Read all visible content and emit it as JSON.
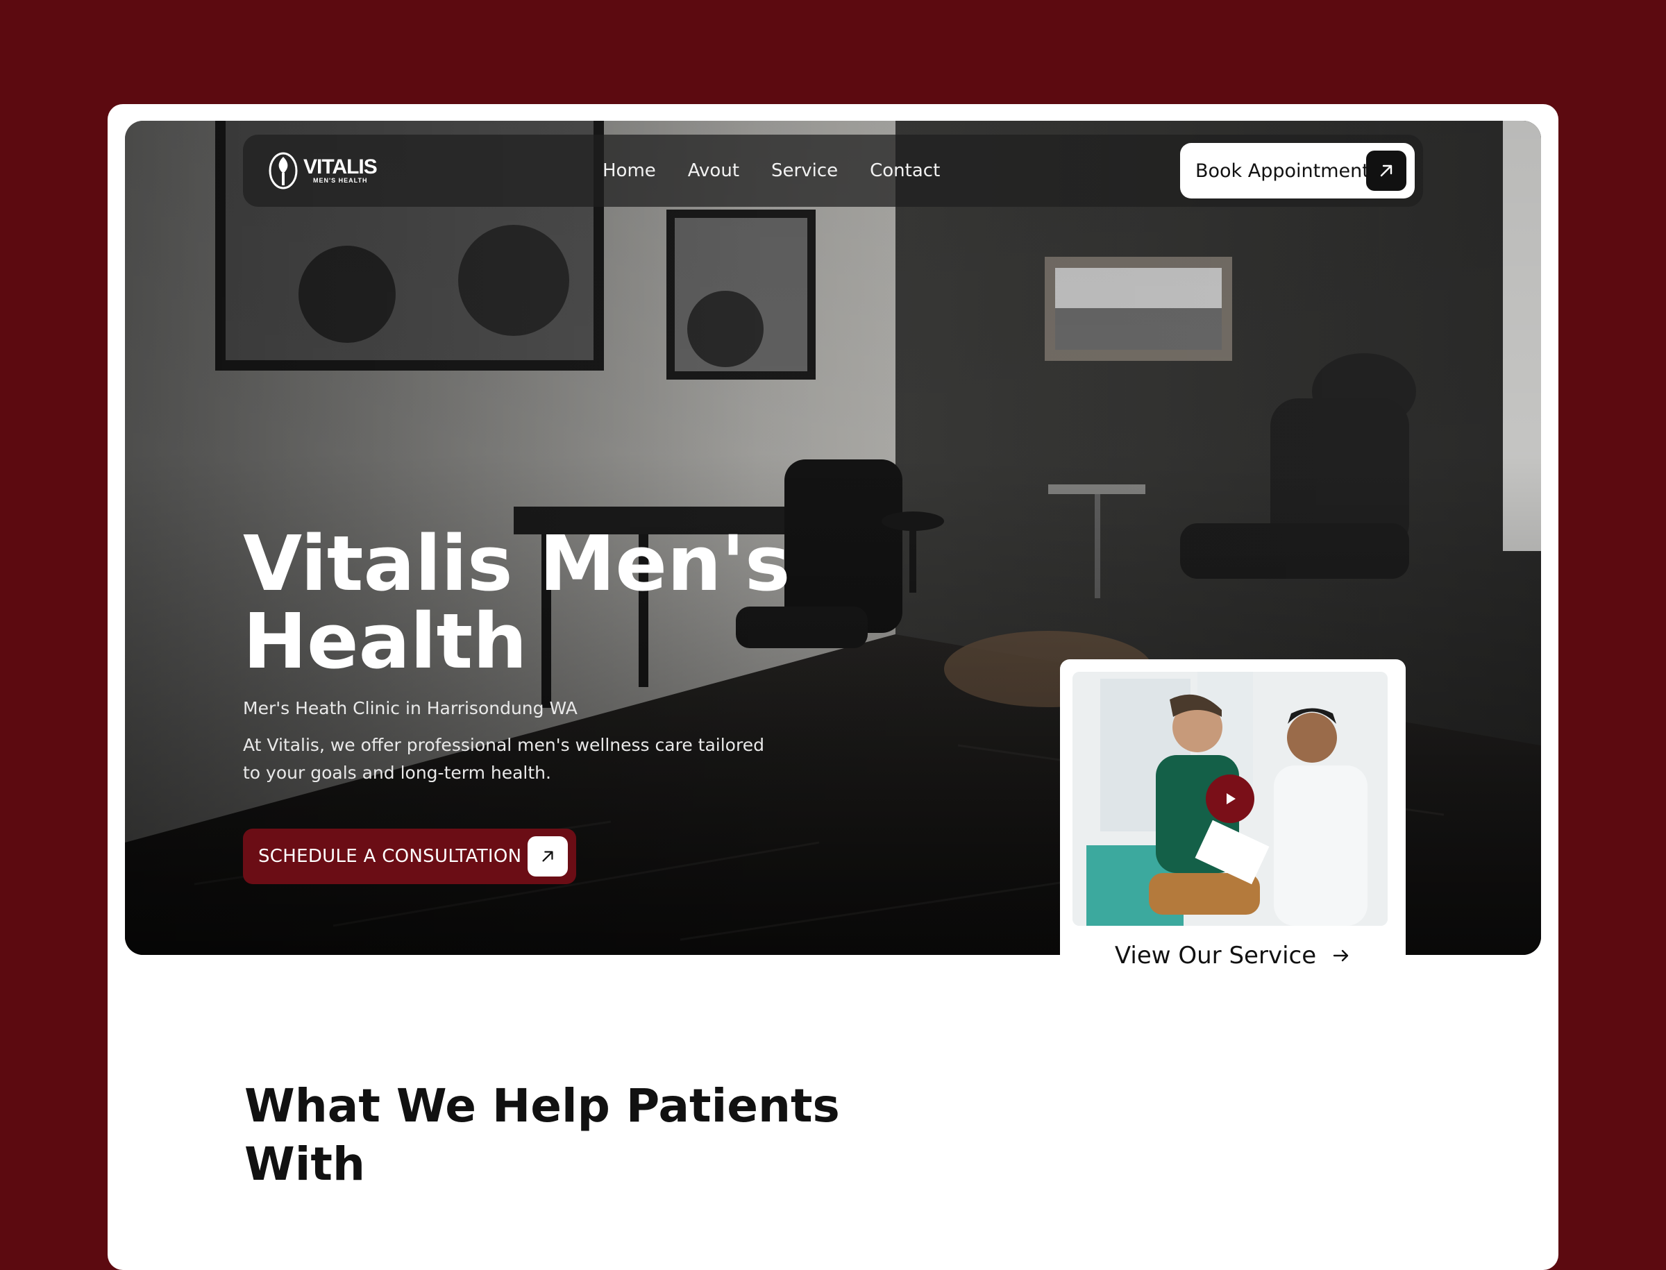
{
  "brand": {
    "name": "VITALIS",
    "tagline": "MEN'S HEALTH",
    "accent_color": "#6b0d15",
    "background_color": "#5c0a10"
  },
  "nav": {
    "links": [
      "Home",
      "Avout",
      "Service",
      "Contact"
    ],
    "book_button": {
      "label": "Book Appointment",
      "icon": "arrow-up-right-icon"
    }
  },
  "hero": {
    "title": "Vitalis Men's Health",
    "subtitle": "Mer's Heath Clinic in Harrisondung WA",
    "description": "At Vitalis, we offer professional men's wellness care tailored to your goals and long-term health.",
    "cta": {
      "label": "SCHEDULE A CONSULTATION",
      "icon": "arrow-up-right-icon"
    }
  },
  "service_card": {
    "label": "View Our Service",
    "icon": "arrow-right-icon",
    "play_icon": "play-icon"
  },
  "section": {
    "heading": "What We Help Patients With"
  }
}
